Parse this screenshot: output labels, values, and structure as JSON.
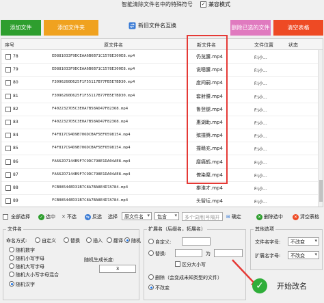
{
  "title": "智能清除文件名中的特殊符号",
  "compat_label": "兼容模式",
  "toolbar": {
    "add_file": "添加文件",
    "add_folder": "添加文件夹",
    "new_old_swap": "新旧文件名互换",
    "clear_dup": "删除已选的文件",
    "clear_table": "清空表格"
  },
  "columns": {
    "num": "序号",
    "orig": "原文件名",
    "new": "新文件名",
    "loc": "文件位置",
    "status": "状态"
  },
  "rows": [
    {
      "num": "78",
      "orig": "ED881033F9DCEAA6B6B71C1578E300E8.mp4",
      "new": "仍览腰.mp4",
      "loc": "F:\\小..."
    },
    {
      "num": "79",
      "orig": "ED881033F9DCEAA6B6B71C1578E300E8.mp4",
      "new": "说嗯腰.mp4",
      "loc": "F:\\小..."
    },
    {
      "num": "80",
      "orig": "F3096260D625F1F55117B77FB5E7BD30.mp4",
      "new": "度间嗣.mp4",
      "loc": "F:\\小..."
    },
    {
      "num": "81",
      "orig": "F3096260D625F1F55117B77FB5E7BD30.mp4",
      "new": "套射腰.mp4",
      "loc": "F:\\小..."
    },
    {
      "num": "82",
      "orig": "F4022327D5C3E0A7B58AD47F82368.mp4",
      "new": "鲁登腿.mp4",
      "loc": "F:\\小..."
    },
    {
      "num": "83",
      "orig": "F4022327D5C3E0A7B58AD47F82368.mp4",
      "new": "惠湖助.mp4",
      "loc": "F:\\小..."
    },
    {
      "num": "84",
      "orig": "F4F817C94D9B706DCBAF5EF6598154.mp4",
      "new": "殡撞腾.mp4",
      "loc": "F:\\小..."
    },
    {
      "num": "85",
      "orig": "F4F817C94D9B706DCBAF5EF6598154.mp4",
      "new": "撞赣充.mp4",
      "loc": "F:\\小..."
    },
    {
      "num": "86",
      "orig": "FA662D7144B9F7C9DC798E1DA04AE8.mp4",
      "new": "靡痛鹤.mp4",
      "loc": "F:\\小..."
    },
    {
      "num": "87",
      "orig": "FA662D7144B9F7C9DC798E1DA04AE8.mp4",
      "new": "僚染麾.mp4",
      "loc": "F:\\小..."
    },
    {
      "num": "88",
      "orig": "FCB08544ED31B7C8A7BA8E4D7A784.mp4",
      "new": "擀淮才.mp4",
      "loc": "F:\\小..."
    },
    {
      "num": "89",
      "orig": "FCB08544ED31B7C8A7BA8E4D7A784.mp4",
      "new": "头智坛.mp4",
      "loc": "F:\\小..."
    }
  ],
  "selbar": {
    "select_all": "全部选择",
    "select": "选中",
    "deselect": "不选",
    "invert": "反选",
    "choose": "选择",
    "orig_name_option": "原文件名",
    "contains_option": "包含",
    "search_placeholder": "多个词用|号隔开",
    "confirm": "确定",
    "delete_selected": "删除选中",
    "clear_table": "清空表格"
  },
  "filename_panel": {
    "title": "文件名",
    "naming_label": "命名方式:",
    "custom": "自定义",
    "replace": "替换",
    "insert": "插入",
    "translate": "翻译",
    "random": "随机",
    "random_digits": "随机数字",
    "random_lower": "随机小写字母",
    "random_upper": "随机大写字母",
    "random_mixed": "随机大小写字母混合",
    "random_chinese": "随机汉字",
    "gen_length_label": "随机生成长度:",
    "gen_length_value": "3"
  },
  "ext_panel": {
    "title": "扩展名（后缀名，拓展名）",
    "custom": "自定义:",
    "replace": "替换:",
    "to": "为",
    "case_sensitive": "区分大小写",
    "delete_label": "删除（会变成未知类型的文件）",
    "unchanged": "不改变"
  },
  "other_panel": {
    "title": "其他选项",
    "filename_case": "文件名字母:",
    "filename_case_value": "不改变",
    "ext_case": "扩展名字母:",
    "ext_case_value": "不改变"
  },
  "start_label": "开始改名",
  "colors": {
    "highlight": "#e53935",
    "green": "#2e9e2e",
    "orange": "#f0a21f",
    "pink": "#e07abf",
    "red": "#ee4a24"
  }
}
